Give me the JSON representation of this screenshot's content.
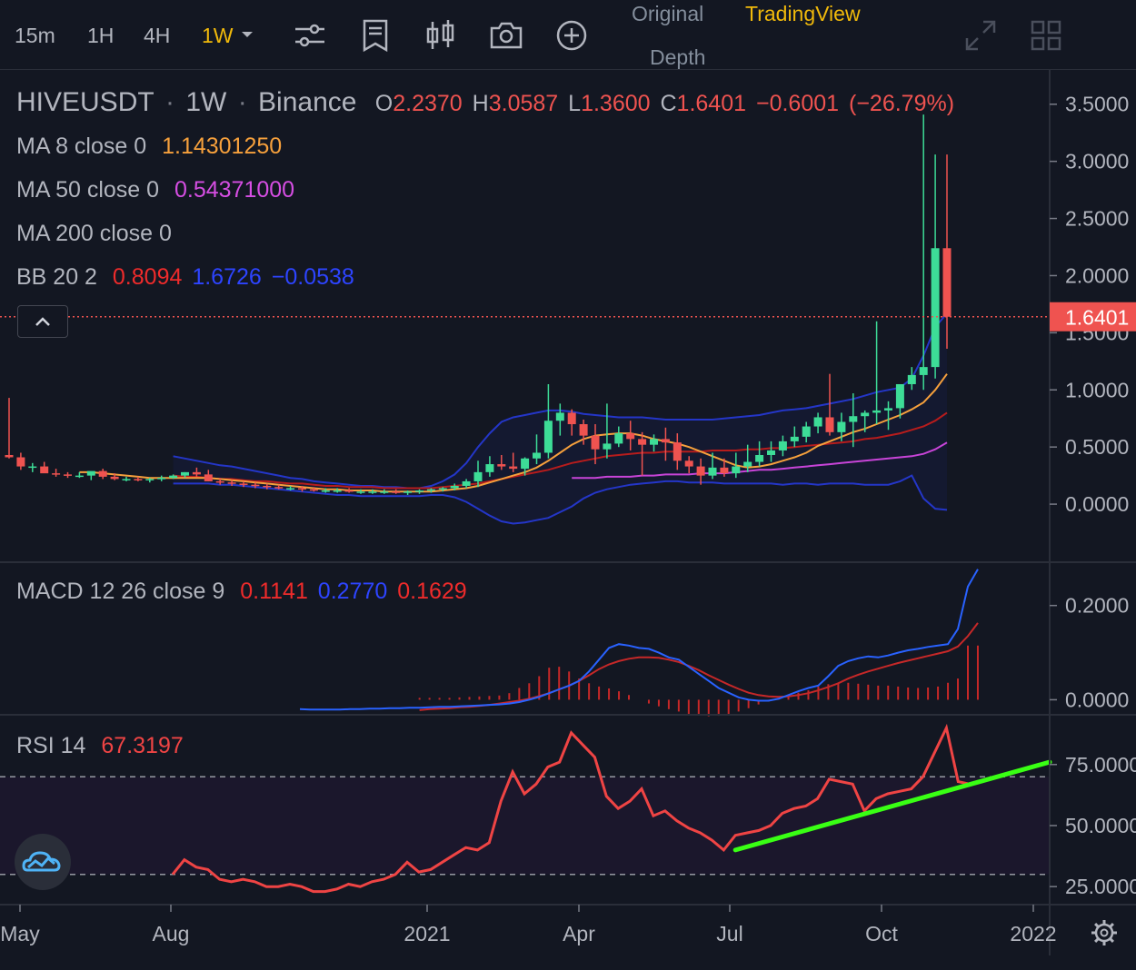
{
  "toolbar": {
    "timeframes": [
      "15m",
      "1H",
      "4H",
      "1W"
    ],
    "active_timeframe": "1W",
    "views": {
      "original": "Original",
      "tradingview": "TradingView",
      "depth": "Depth"
    },
    "icons": [
      "indicators-icon",
      "template-icon",
      "chart-type-icon",
      "camera-icon",
      "add-icon",
      "fullscreen-icon",
      "layout-icon"
    ]
  },
  "legend": {
    "symbol": "HIVEUSDT",
    "interval": "1W",
    "exchange": "Binance",
    "ohlc": {
      "o_label": "O",
      "o": "2.2370",
      "h_label": "H",
      "h": "3.0587",
      "l_label": "L",
      "l": "1.3600",
      "c_label": "C",
      "c": "1.6401",
      "change": "−0.6001",
      "change_pct": "(−26.79%)"
    },
    "ma8": {
      "label": "MA 8 close 0",
      "value": "1.14301250"
    },
    "ma50": {
      "label": "MA 50 close 0",
      "value": "0.54371000"
    },
    "ma200": {
      "label": "MA 200 close 0"
    },
    "bb": {
      "label": "BB 20 2",
      "v1": "0.8094",
      "v2": "1.6726",
      "v3": "−0.0538"
    },
    "macd": {
      "label": "MACD 12 26 close 9",
      "v1": "0.1141",
      "v2": "0.2770",
      "v3": "0.1629"
    },
    "rsi": {
      "label": "RSI 14",
      "value": "67.3197"
    }
  },
  "colors": {
    "background": "#131722",
    "up": "#26a69a",
    "candle_up": "#3ddc97",
    "down": "#ef5350",
    "accent": "#f0b90b",
    "ma8": "#f6a03c",
    "ma50": "#c844d8",
    "ma200": "#b71c1c",
    "bb_band": "#2436c8",
    "macd_line": "#2962ff",
    "signal_line": "#c62828",
    "rsi_line": "#ef4444",
    "trend_line": "#39ff14"
  },
  "chart_data": [
    {
      "type": "candlestick",
      "title": "HIVEUSDT · 1W · Binance",
      "y_axis_ticks": [
        "3.5000",
        "3.0000",
        "2.5000",
        "2.0000",
        "1.5000",
        "1.0000",
        "0.5000",
        "0.0000"
      ],
      "ylim": [
        -0.5,
        3.8
      ],
      "last_price_label": "1.6401",
      "x_axis_ticks": [
        "May",
        "Aug",
        "2021",
        "Apr",
        "Jul",
        "Oct",
        "2022"
      ],
      "x": [
        0,
        1,
        2,
        3,
        4,
        5,
        6,
        7,
        8,
        9,
        10,
        11,
        12,
        13,
        14,
        15,
        16,
        17,
        18,
        19,
        20,
        21,
        22,
        23,
        24,
        25,
        26,
        27,
        28,
        29,
        30,
        31,
        32,
        33,
        34,
        35,
        36,
        37,
        38,
        39,
        40,
        41,
        42,
        43,
        44,
        45,
        46,
        47,
        48,
        49,
        50,
        51,
        52,
        53,
        54,
        55,
        56,
        57,
        58,
        59,
        60,
        61,
        62,
        63,
        64,
        65,
        66,
        67,
        68,
        69,
        70,
        71,
        72,
        73,
        74,
        75,
        76,
        77,
        78,
        79,
        80,
        81,
        82,
        83,
        84,
        85,
        86,
        87,
        88,
        89,
        90,
        91,
        92,
        93,
        94,
        95
      ],
      "open": [
        0.43,
        0.41,
        0.32,
        0.33,
        0.27,
        0.26,
        0.25,
        0.25,
        0.29,
        0.24,
        0.22,
        0.22,
        0.21,
        0.22,
        0.23,
        0.25,
        0.28,
        0.26,
        0.2,
        0.19,
        0.18,
        0.17,
        0.16,
        0.15,
        0.14,
        0.14,
        0.13,
        0.12,
        0.12,
        0.12,
        0.11,
        0.11,
        0.11,
        0.11,
        0.1,
        0.11,
        0.12,
        0.13,
        0.14,
        0.16,
        0.2,
        0.28,
        0.35,
        0.33,
        0.31,
        0.4,
        0.45,
        0.73,
        0.8,
        0.7,
        0.6,
        0.48,
        0.53,
        0.62,
        0.57,
        0.52,
        0.57,
        0.54,
        0.38,
        0.33,
        0.25,
        0.32,
        0.27,
        0.33,
        0.37,
        0.43,
        0.47,
        0.55,
        0.59,
        0.68,
        0.76,
        0.63,
        0.72,
        0.77,
        0.8,
        0.82,
        0.84,
        1.05,
        1.13,
        1.2,
        2.24
      ],
      "high": [
        0.93,
        0.45,
        0.36,
        0.37,
        0.31,
        0.28,
        0.28,
        0.27,
        0.31,
        0.27,
        0.24,
        0.24,
        0.23,
        0.25,
        0.26,
        0.28,
        0.32,
        0.3,
        0.23,
        0.21,
        0.2,
        0.19,
        0.18,
        0.17,
        0.16,
        0.16,
        0.15,
        0.14,
        0.14,
        0.14,
        0.13,
        0.13,
        0.13,
        0.13,
        0.12,
        0.13,
        0.14,
        0.15,
        0.18,
        0.22,
        0.38,
        0.42,
        0.43,
        0.45,
        0.41,
        0.61,
        1.05,
        0.88,
        0.83,
        0.74,
        0.7,
        0.88,
        0.68,
        0.73,
        0.63,
        0.61,
        0.67,
        0.62,
        0.42,
        0.4,
        0.45,
        0.4,
        0.45,
        0.52,
        0.55,
        0.55,
        0.6,
        0.68,
        0.72,
        0.8,
        1.14,
        0.8,
        0.97,
        0.82,
        1.6,
        0.9,
        0.98,
        1.2,
        3.41,
        3.06,
        3.06
      ],
      "low": [
        0.4,
        0.3,
        0.28,
        0.28,
        0.24,
        0.23,
        0.23,
        0.21,
        0.22,
        0.21,
        0.2,
        0.2,
        0.19,
        0.2,
        0.22,
        0.23,
        0.24,
        0.2,
        0.17,
        0.16,
        0.15,
        0.14,
        0.13,
        0.13,
        0.12,
        0.11,
        0.11,
        0.1,
        0.1,
        0.1,
        0.09,
        0.09,
        0.09,
        0.09,
        0.08,
        0.09,
        0.1,
        0.11,
        0.12,
        0.14,
        0.15,
        0.24,
        0.3,
        0.28,
        0.25,
        0.35,
        0.4,
        0.6,
        0.6,
        0.52,
        0.35,
        0.4,
        0.5,
        0.47,
        0.25,
        0.46,
        0.38,
        0.3,
        0.27,
        0.17,
        0.22,
        0.24,
        0.23,
        0.28,
        0.33,
        0.37,
        0.42,
        0.5,
        0.54,
        0.62,
        0.6,
        0.55,
        0.5,
        0.63,
        0.7,
        0.65,
        0.75,
        1.0,
        1.0,
        1.1,
        1.36
      ],
      "close": [
        0.41,
        0.33,
        0.33,
        0.27,
        0.26,
        0.25,
        0.25,
        0.29,
        0.24,
        0.22,
        0.22,
        0.21,
        0.22,
        0.23,
        0.25,
        0.28,
        0.26,
        0.2,
        0.19,
        0.18,
        0.17,
        0.16,
        0.15,
        0.14,
        0.14,
        0.13,
        0.12,
        0.12,
        0.12,
        0.11,
        0.11,
        0.11,
        0.11,
        0.1,
        0.11,
        0.12,
        0.13,
        0.14,
        0.16,
        0.2,
        0.28,
        0.35,
        0.33,
        0.31,
        0.4,
        0.45,
        0.73,
        0.8,
        0.7,
        0.6,
        0.48,
        0.53,
        0.62,
        0.57,
        0.52,
        0.57,
        0.54,
        0.38,
        0.33,
        0.25,
        0.32,
        0.27,
        0.33,
        0.37,
        0.43,
        0.47,
        0.55,
        0.59,
        0.68,
        0.76,
        0.63,
        0.72,
        0.77,
        0.8,
        0.82,
        0.84,
        1.05,
        1.13,
        1.2,
        2.24,
        1.64
      ],
      "ma8": [
        null,
        null,
        null,
        null,
        null,
        null,
        0.28,
        0.28,
        0.27,
        0.26,
        0.25,
        0.24,
        0.23,
        0.23,
        0.23,
        0.23,
        0.23,
        0.23,
        0.22,
        0.21,
        0.2,
        0.19,
        0.18,
        0.17,
        0.16,
        0.15,
        0.14,
        0.13,
        0.13,
        0.12,
        0.12,
        0.12,
        0.11,
        0.11,
        0.11,
        0.11,
        0.11,
        0.12,
        0.13,
        0.14,
        0.16,
        0.19,
        0.22,
        0.25,
        0.28,
        0.32,
        0.38,
        0.45,
        0.52,
        0.57,
        0.6,
        0.61,
        0.62,
        0.62,
        0.6,
        0.57,
        0.55,
        0.53,
        0.5,
        0.46,
        0.42,
        0.38,
        0.34,
        0.32,
        0.33,
        0.35,
        0.38,
        0.41,
        0.45,
        0.51,
        0.55,
        0.59,
        0.63,
        0.66,
        0.7,
        0.74,
        0.78,
        0.83,
        0.89,
        1.0,
        1.14
      ],
      "bb_mid": [
        null,
        null,
        null,
        null,
        null,
        null,
        null,
        null,
        null,
        null,
        null,
        null,
        null,
        null,
        0.3,
        0.29,
        0.28,
        0.27,
        0.26,
        0.25,
        0.24,
        0.23,
        0.22,
        0.21,
        0.2,
        0.19,
        0.18,
        0.17,
        0.16,
        0.15,
        0.14,
        0.14,
        0.13,
        0.13,
        0.12,
        0.12,
        0.12,
        0.13,
        0.14,
        0.16,
        0.18,
        0.21,
        0.24,
        0.27,
        0.3,
        0.34,
        0.37,
        0.4,
        0.42,
        0.44,
        0.45,
        0.46,
        0.47,
        0.48,
        0.48,
        0.48,
        0.48,
        0.48,
        0.47,
        0.46,
        0.45,
        0.45,
        0.45,
        0.45,
        0.46,
        0.47,
        0.48,
        0.5,
        0.52,
        0.54,
        0.56,
        0.58,
        0.6,
        0.62,
        0.64,
        0.66,
        0.68,
        0.71,
        0.74,
        0.78,
        0.81
      ],
      "bb_upper": [
        null,
        null,
        null,
        null,
        null,
        null,
        null,
        null,
        null,
        null,
        null,
        null,
        null,
        null,
        0.42,
        0.4,
        0.38,
        0.36,
        0.34,
        0.33,
        0.31,
        0.29,
        0.27,
        0.25,
        0.23,
        0.22,
        0.2,
        0.19,
        0.18,
        0.17,
        0.16,
        0.16,
        0.15,
        0.15,
        0.14,
        0.14,
        0.16,
        0.2,
        0.26,
        0.36,
        0.5,
        0.62,
        0.72,
        0.76,
        0.78,
        0.8,
        0.82,
        0.82,
        0.81,
        0.79,
        0.78,
        0.77,
        0.76,
        0.76,
        0.76,
        0.75,
        0.74,
        0.74,
        0.74,
        0.74,
        0.74,
        0.75,
        0.76,
        0.77,
        0.78,
        0.8,
        0.82,
        0.83,
        0.84,
        0.86,
        0.88,
        0.9,
        0.92,
        0.95,
        0.98,
        1.0,
        1.02,
        1.1,
        1.3,
        1.55,
        1.67
      ],
      "bb_lower": [
        null,
        null,
        null,
        null,
        null,
        null,
        null,
        null,
        null,
        null,
        null,
        null,
        null,
        null,
        0.18,
        0.18,
        0.18,
        0.18,
        0.17,
        0.17,
        0.16,
        0.15,
        0.14,
        0.13,
        0.12,
        0.11,
        0.1,
        0.09,
        0.08,
        0.08,
        0.07,
        0.07,
        0.07,
        0.07,
        0.07,
        0.07,
        0.08,
        0.08,
        0.06,
        0.02,
        -0.04,
        -0.1,
        -0.15,
        -0.17,
        -0.16,
        -0.14,
        -0.12,
        -0.07,
        -0.02,
        0.05,
        0.1,
        0.13,
        0.15,
        0.17,
        0.18,
        0.19,
        0.2,
        0.2,
        0.19,
        0.19,
        0.19,
        0.18,
        0.18,
        0.18,
        0.18,
        0.18,
        0.17,
        0.18,
        0.18,
        0.17,
        0.18,
        0.18,
        0.18,
        0.17,
        0.17,
        0.17,
        0.2,
        0.25,
        0.05,
        -0.04,
        -0.05
      ],
      "ma50": [
        null,
        null,
        null,
        null,
        null,
        null,
        null,
        null,
        null,
        null,
        null,
        null,
        null,
        null,
        null,
        null,
        null,
        null,
        null,
        null,
        null,
        null,
        null,
        null,
        null,
        null,
        null,
        null,
        null,
        null,
        null,
        null,
        null,
        null,
        null,
        null,
        null,
        null,
        null,
        null,
        null,
        null,
        null,
        null,
        null,
        null,
        null,
        null,
        0.23,
        0.23,
        0.23,
        0.24,
        0.24,
        0.24,
        0.25,
        0.25,
        0.26,
        0.26,
        0.26,
        0.27,
        0.27,
        0.27,
        0.28,
        0.29,
        0.3,
        0.3,
        0.31,
        0.32,
        0.33,
        0.34,
        0.35,
        0.36,
        0.37,
        0.38,
        0.39,
        0.4,
        0.41,
        0.42,
        0.44,
        0.48,
        0.54
      ],
      "ma200": [
        null,
        null,
        null,
        null,
        null,
        null,
        null,
        null,
        null,
        null,
        null,
        null,
        null,
        null,
        0.25,
        0.24,
        0.24,
        0.23,
        0.22,
        0.22,
        0.21,
        0.2,
        0.2,
        0.19,
        0.18,
        0.18,
        0.17,
        0.16,
        0.16,
        0.15,
        0.15,
        0.15,
        0.14,
        0.14,
        0.14,
        0.14,
        0.14,
        0.15,
        0.16,
        0.17,
        0.18,
        0.2,
        0.22,
        0.24,
        0.26,
        0.28,
        0.3,
        0.33,
        0.36,
        0.38,
        0.4,
        0.42,
        0.43,
        0.44,
        0.45,
        0.45,
        0.46,
        0.46,
        0.46,
        0.46,
        0.47,
        0.47,
        0.47,
        0.48,
        0.48,
        0.49,
        0.49,
        0.5,
        0.51,
        0.52,
        0.53,
        0.54,
        0.55,
        0.57,
        0.58,
        0.6,
        0.62,
        0.65,
        0.68,
        0.73,
        0.8
      ]
    },
    {
      "type": "line",
      "title": "MACD 12 26 close 9",
      "y_axis_ticks": [
        "0.2000",
        "0.0000"
      ],
      "ylim": [
        -0.03,
        0.29
      ],
      "macd": [
        -0.02,
        -0.021,
        -0.021,
        -0.021,
        -0.021,
        -0.02,
        -0.02,
        -0.019,
        -0.019,
        -0.018,
        -0.018,
        -0.017,
        -0.017,
        -0.016,
        -0.015,
        -0.015,
        -0.014,
        -0.013,
        -0.012,
        -0.011,
        -0.01,
        -0.008,
        -0.005,
        0.0,
        0.006,
        0.014,
        0.022,
        0.03,
        0.04,
        0.06,
        0.085,
        0.11,
        0.118,
        0.115,
        0.11,
        0.108,
        0.1,
        0.09,
        0.085,
        0.07,
        0.055,
        0.04,
        0.025,
        0.015,
        0.005,
        0.0,
        -0.002,
        -0.002,
        0.002,
        0.01,
        0.018,
        0.025,
        0.03,
        0.05,
        0.072,
        0.082,
        0.088,
        0.092,
        0.09,
        0.094,
        0.1,
        0.105,
        0.108,
        0.112,
        0.115,
        0.118,
        0.15,
        0.24,
        0.277
      ],
      "signal": [
        null,
        null,
        null,
        null,
        null,
        null,
        null,
        null,
        null,
        null,
        null,
        null,
        -0.022,
        -0.02,
        -0.019,
        -0.018,
        -0.016,
        -0.015,
        -0.013,
        -0.011,
        -0.008,
        -0.005,
        -0.002,
        0.002,
        0.008,
        0.014,
        0.022,
        0.03,
        0.04,
        0.052,
        0.065,
        0.075,
        0.082,
        0.087,
        0.09,
        0.09,
        0.089,
        0.085,
        0.08,
        0.072,
        0.063,
        0.052,
        0.042,
        0.032,
        0.023,
        0.015,
        0.01,
        0.007,
        0.006,
        0.007,
        0.01,
        0.014,
        0.02,
        0.027,
        0.035,
        0.045,
        0.053,
        0.06,
        0.066,
        0.072,
        0.078,
        0.083,
        0.088,
        0.093,
        0.098,
        0.103,
        0.113,
        0.135,
        0.163
      ],
      "histogram": [
        null,
        null,
        null,
        null,
        null,
        null,
        null,
        null,
        null,
        null,
        null,
        null,
        0.004,
        0.004,
        0.004,
        0.004,
        0.005,
        0.006,
        0.007,
        0.008,
        0.009,
        0.014,
        0.025,
        0.035,
        0.05,
        0.068,
        0.07,
        0.06,
        0.045,
        0.035,
        0.028,
        0.024,
        0.018,
        0.01,
        0.0,
        -0.008,
        -0.014,
        -0.02,
        -0.025,
        -0.03,
        -0.033,
        -0.035,
        -0.034,
        -0.03,
        -0.025,
        -0.018,
        -0.01,
        -0.004,
        0.004,
        0.01,
        0.015,
        0.02,
        0.028,
        0.033,
        0.035,
        0.036,
        0.034,
        0.032,
        0.03,
        0.03,
        0.028,
        0.026,
        0.025,
        0.026,
        0.028,
        0.036,
        0.045,
        0.115,
        0.115
      ]
    },
    {
      "type": "line",
      "title": "RSI 14",
      "y_axis_ticks": [
        "75.0000",
        "50.0000",
        "25.0000"
      ],
      "ylim": [
        18,
        95
      ],
      "band": [
        30,
        70
      ],
      "rsi": [
        30,
        36,
        33,
        32,
        28,
        27,
        28,
        27,
        25,
        25,
        26,
        25,
        23,
        23,
        24,
        26,
        25,
        27,
        28,
        30,
        35,
        31,
        32,
        35,
        38,
        41,
        40,
        43,
        60,
        72,
        63,
        67,
        74,
        76,
        88,
        83,
        78,
        62,
        57,
        60,
        65,
        54,
        56,
        52,
        49,
        47,
        44,
        40,
        46,
        47,
        48,
        50,
        55,
        57,
        58,
        61,
        69,
        68,
        67,
        56,
        61,
        63,
        64,
        65,
        70,
        80,
        90,
        68,
        67
      ],
      "trend_line": {
        "from": [
          48,
          40
        ],
        "to": [
          72,
          76
        ]
      }
    }
  ]
}
